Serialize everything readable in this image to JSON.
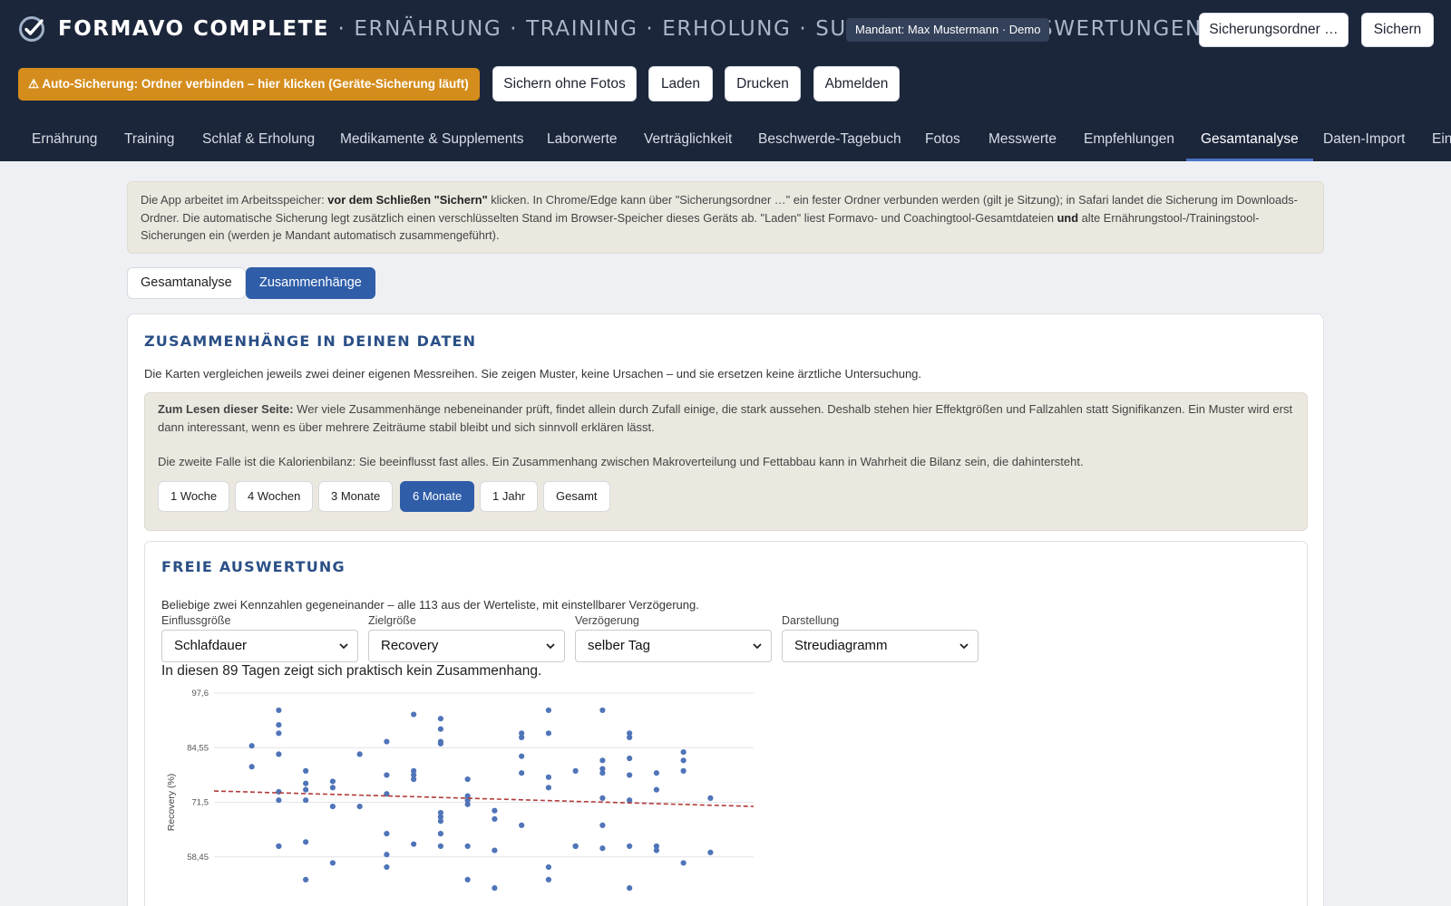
{
  "header": {
    "brand": "FORMAVO COMPLETE",
    "brand_sections": "· ERNÄHRUNG · TRAINING · ERHOLUNG · SUPPLEMENTE · AUSWERTUNGEN",
    "mandant": "Mandant: Max Mustermann · Demo",
    "folder_button": "Sicherungsordner …",
    "save_button": "Sichern",
    "auto_backup_warning": "⚠ Auto-Sicherung: Ordner verbinden – hier klicken (Geräte-Sicherung läuft)",
    "save_without_photos": "Sichern ohne Fotos",
    "load": "Laden",
    "print": "Drucken",
    "logout": "Abmelden"
  },
  "nav": {
    "active": "Gesamtanalyse",
    "tabs": [
      "Ernährung",
      "Training",
      "Schlaf & Erholung",
      "Medikamente & Supplements",
      "Laborwerte",
      "Verträglichkeit",
      "Beschwerde-Tagebuch",
      "Fotos",
      "Messwerte",
      "Empfehlungen",
      "Gesamtanalyse",
      "Daten-Import",
      "Ein"
    ]
  },
  "info": {
    "t1": "Die App arbeitet im Arbeitsspeicher: ",
    "b1": "vor dem Schließen \"Sichern\"",
    "t2": " klicken. In Chrome/Edge kann über \"Sicherungsordner …\" ein fester Ordner verbunden werden (gilt je Sitzung); in Safari landet die Sicherung im Downloads-Ordner. Die automatische Sicherung legt zusätzlich einen verschlüsselten Stand im Browser-Speicher dieses Geräts ab. \"Laden\" liest Formavo- und Coachingtool-Gesamtdateien ",
    "b2": "und",
    "t3": " alte Ernährungstool-/Trainingstool-Sicherungen ein (werden je Mandant automatisch zusammengeführt)."
  },
  "subtabs": {
    "inactive": "Gesamtanalyse",
    "active": "Zusammenhänge"
  },
  "section": {
    "title": "ZUSAMMENHÄNGE IN DEINEN DATEN",
    "desc": "Die Karten vergleichen jeweils zwei deiner eigenen Messreihen. Sie zeigen Muster, keine Ursachen – und sie ersetzen keine ärztliche Untersuchung.",
    "read_bold": "Zum Lesen dieser Seite:",
    "read_text": " Wer viele Zusammenhänge nebeneinander prüft, findet allein durch Zufall einige, die stark aussehen. Deshalb stehen hier Effektgrößen und Fallzahlen statt Signifikanzen. Ein Muster wird erst dann interessant, wenn es über mehrere Zeiträume stabil bleibt und sich sinnvoll erklären lässt.",
    "read_text2": "Die zweite Falle ist die Kalorienbilanz: Sie beeinflusst fast alles. Ein Zusammenhang zwischen Makroverteilung und Fettabbau kann in Wahrheit die Bilanz sein, die dahintersteht.",
    "ranges": [
      "1 Woche",
      "4 Wochen",
      "3 Monate",
      "6 Monate",
      "1 Jahr",
      "Gesamt"
    ],
    "active_range": "6 Monate"
  },
  "free": {
    "title": "FREIE AUSWERTUNG",
    "desc": "Beliebige zwei Kennzahlen gegeneinander – alle 113 aus der Werteliste, mit einstellbarer Verzögerung.",
    "labels": {
      "influence": "Einflussgröße",
      "target": "Zielgröße",
      "delay": "Verzögerung",
      "display": "Darstellung"
    },
    "values": {
      "influence": "Schlafdauer",
      "target": "Recovery",
      "delay": "selber Tag",
      "display": "Streudiagramm"
    },
    "summary": "In diesen 89 Tagen zeigt sich praktisch kein Zusammenhang."
  },
  "colors": {
    "navy": "#1b263b",
    "accent": "#2f5da8",
    "warning": "#d48d1c",
    "point": "#4f74b8",
    "trend": "#b23a3a"
  },
  "chart_data": {
    "type": "scatter",
    "ylabel": "Recovery (%)",
    "yticks": [
      "97,6",
      "84,55",
      "71,5",
      "58,45"
    ],
    "ytick_values": [
      97.6,
      84.55,
      71.5,
      58.45
    ],
    "ylim": [
      45.4,
      97.6
    ],
    "xlim": [
      0,
      20
    ],
    "trend": {
      "x": [
        0,
        20
      ],
      "y": [
        74.2,
        70.5
      ]
    },
    "points": [
      [
        1.4,
        85.0
      ],
      [
        1.4,
        80.0
      ],
      [
        2.4,
        93.5
      ],
      [
        2.4,
        90.0
      ],
      [
        2.4,
        88.0
      ],
      [
        2.4,
        83.0
      ],
      [
        2.4,
        74.0
      ],
      [
        2.4,
        72.0
      ],
      [
        2.4,
        61.0
      ],
      [
        2.4,
        61.0
      ],
      [
        3.4,
        79.0
      ],
      [
        3.4,
        76.0
      ],
      [
        3.4,
        74.5
      ],
      [
        3.4,
        72.0
      ],
      [
        3.4,
        62.0
      ],
      [
        3.4,
        53.0
      ],
      [
        4.4,
        76.5
      ],
      [
        4.4,
        75.0
      ],
      [
        4.4,
        70.5
      ],
      [
        4.4,
        57.0
      ],
      [
        5.4,
        83.0
      ],
      [
        5.4,
        70.5
      ],
      [
        6.4,
        86.0
      ],
      [
        6.4,
        78.0
      ],
      [
        6.4,
        73.5
      ],
      [
        6.4,
        64.0
      ],
      [
        6.4,
        59.0
      ],
      [
        6.4,
        56.0
      ],
      [
        7.4,
        92.5
      ],
      [
        7.4,
        79.0
      ],
      [
        7.4,
        78.0
      ],
      [
        7.4,
        77.0
      ],
      [
        7.4,
        61.5
      ],
      [
        8.4,
        91.5
      ],
      [
        8.4,
        89.0
      ],
      [
        8.4,
        86.0
      ],
      [
        8.4,
        85.5
      ],
      [
        8.4,
        69.0
      ],
      [
        8.4,
        68.0
      ],
      [
        8.4,
        67.0
      ],
      [
        8.4,
        64.0
      ],
      [
        8.4,
        61.0
      ],
      [
        9.4,
        77.0
      ],
      [
        9.4,
        73.0
      ],
      [
        9.4,
        72.0
      ],
      [
        9.4,
        71.0
      ],
      [
        9.4,
        61.0
      ],
      [
        9.4,
        53.0
      ],
      [
        10.4,
        69.5
      ],
      [
        10.4,
        67.5
      ],
      [
        10.4,
        60.0
      ],
      [
        10.4,
        51.0
      ],
      [
        11.4,
        88.0
      ],
      [
        11.4,
        87.0
      ],
      [
        11.4,
        82.5
      ],
      [
        11.4,
        78.5
      ],
      [
        11.4,
        66.0
      ],
      [
        12.4,
        93.5
      ],
      [
        12.4,
        88.0
      ],
      [
        12.4,
        77.5
      ],
      [
        12.4,
        75.0
      ],
      [
        12.4,
        56.0
      ],
      [
        12.4,
        53.0
      ],
      [
        13.4,
        79.0
      ],
      [
        13.4,
        61.0
      ],
      [
        13.4,
        61.0
      ],
      [
        14.4,
        93.5
      ],
      [
        14.4,
        81.5
      ],
      [
        14.4,
        79.5
      ],
      [
        14.4,
        78.5
      ],
      [
        14.4,
        72.5
      ],
      [
        14.4,
        66.0
      ],
      [
        14.4,
        60.5
      ],
      [
        15.4,
        88.0
      ],
      [
        15.4,
        87.0
      ],
      [
        15.4,
        82.0
      ],
      [
        15.4,
        78.0
      ],
      [
        15.4,
        72.0
      ],
      [
        15.4,
        61.0
      ],
      [
        15.4,
        51.0
      ],
      [
        16.4,
        78.5
      ],
      [
        16.4,
        74.5
      ],
      [
        16.4,
        61.0
      ],
      [
        16.4,
        60.0
      ],
      [
        17.4,
        83.5
      ],
      [
        17.4,
        81.5
      ],
      [
        17.4,
        79.0
      ],
      [
        17.4,
        57.0
      ],
      [
        18.4,
        72.5
      ],
      [
        18.4,
        59.5
      ]
    ]
  }
}
